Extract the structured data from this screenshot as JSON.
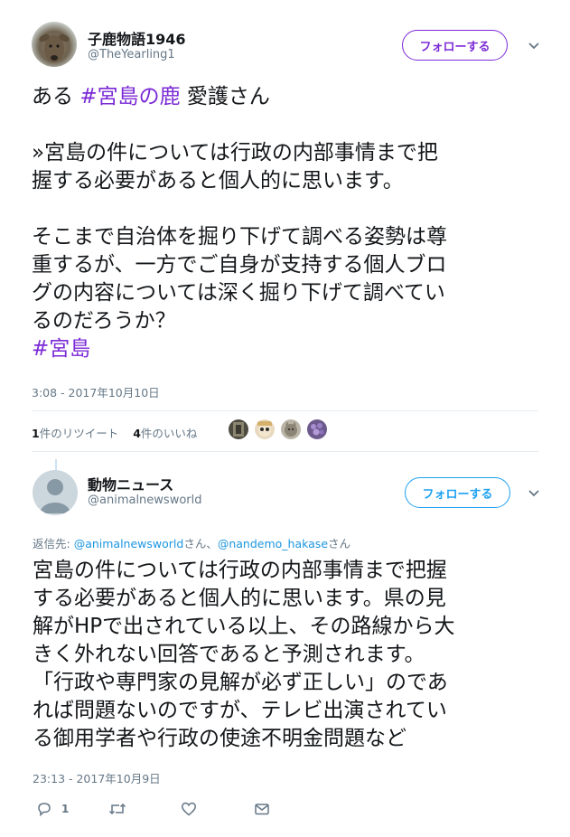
{
  "main_tweet": {
    "author_name": "子鹿物語1946",
    "author_handle": "@TheYearling1",
    "follow_label": "フォローする",
    "text_prefix": "ある ",
    "text_hashtag": "#宮島の鹿",
    "text_after_hashtag": " 愛護さん",
    "quote_line1": "»宮島の件については行政の内部事情まで把",
    "quote_line2": "握する必要があると個人的に思います。",
    "para_line1": "そこまで自治体を掘り下げて調べる姿勢は尊",
    "para_line2": "重するが、一方でご自身が支持する個人ブロ",
    "para_line3": "グの内容については深く掘り下げて調べてい",
    "para_line4": "るのだろうか？",
    "closing_hashtag": "#宮島",
    "timestamp": "3:08 - 2017年10月10日",
    "retweet_count": "1",
    "retweet_label": "件のリツイート",
    "like_count": "4",
    "like_label": "件のいいね"
  },
  "reply_tweet": {
    "author_name": "動物ニュース",
    "author_handle": "@animalnewsworld",
    "follow_label": "フォローする",
    "reply_prefix": "返信先: ",
    "reply_user1": "@animalnewsworld",
    "reply_sep": "さん、",
    "reply_user2": "@nandemo_hakase",
    "reply_suffix": "さん",
    "line1": "宮島の件については行政の内部事情まで把握",
    "line2": "する必要があると個人的に思います。県の見",
    "line3": "解がHPで出されている以上、その路線から大",
    "line4": "きく外れない回答であると予測されます。",
    "line5": "「行政や専門家の見解が必ず正しい」のであ",
    "line6": "れば問題ないのですが、テレビ出演されてい",
    "line7": "る御用学者や行政の使途不明金問題など",
    "timestamp": "23:13 - 2017年10月9日",
    "reply_count": "1"
  },
  "colors": {
    "hashtag": "#7b2ad6",
    "follow_main": "#7b2ad6",
    "follow_reply": "#1da1f2",
    "link": "#1b95e0",
    "secondary_text": "#657786"
  },
  "icons": [
    "chevron-down-icon",
    "reply-icon",
    "retweet-icon",
    "like-icon",
    "message-icon"
  ]
}
